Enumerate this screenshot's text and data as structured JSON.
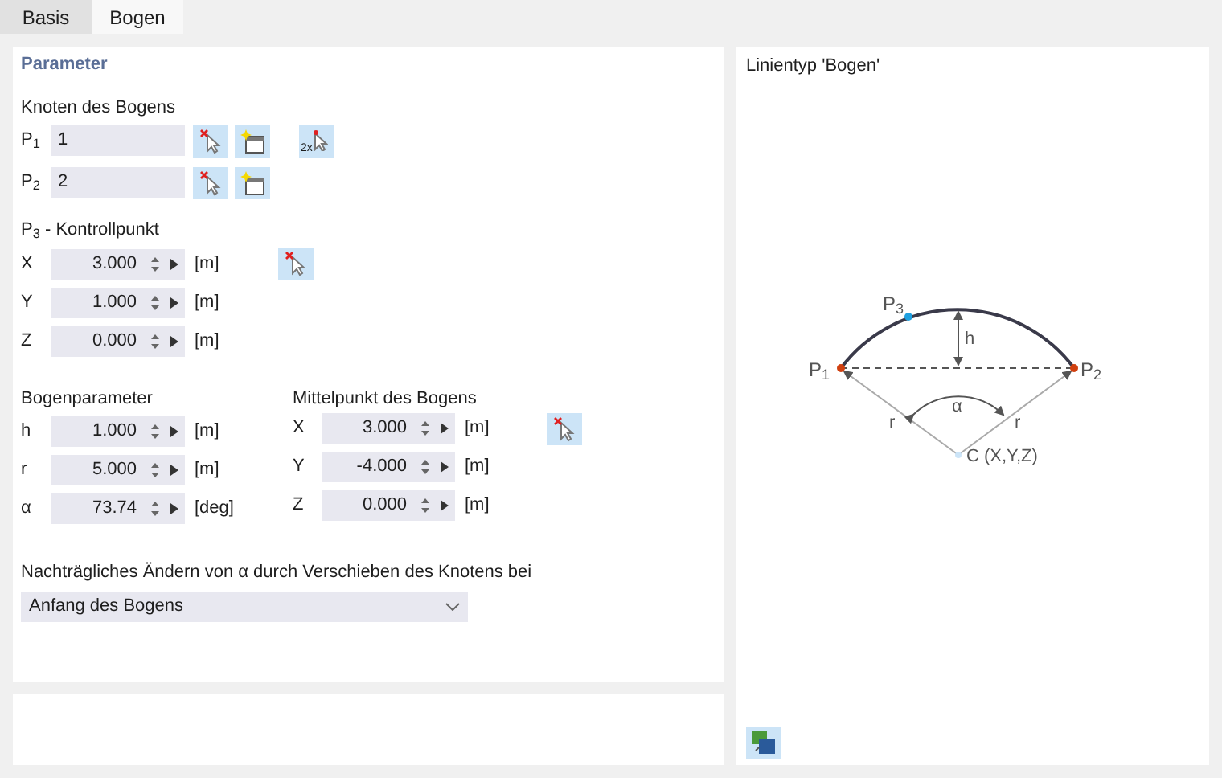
{
  "tabs": [
    {
      "label": "Basis",
      "selected": false
    },
    {
      "label": "Bogen",
      "selected": true
    }
  ],
  "parameter": {
    "title": "Parameter",
    "nodes": {
      "title": "Knoten des Bogens",
      "double_pick_label": "2x",
      "rows": [
        {
          "label": "P$_{1}$",
          "value": "1"
        },
        {
          "label": "P$_{2}$",
          "value": "2"
        }
      ]
    },
    "control_point": {
      "title": "P$_{3}$ - Kontrollpunkt",
      "rows": [
        {
          "label": "X",
          "value": "3.000",
          "unit": "[m]"
        },
        {
          "label": "Y",
          "value": "1.000",
          "unit": "[m]"
        },
        {
          "label": "Z",
          "value": "0.000",
          "unit": "[m]"
        }
      ]
    },
    "arc_parameters": {
      "title": "Bogenparameter",
      "rows": [
        {
          "label": "h",
          "value": "1.000",
          "unit": "[m]"
        },
        {
          "label": "r",
          "value": "5.000",
          "unit": "[m]"
        },
        {
          "label": "α",
          "value": "73.74",
          "unit": "[deg]"
        }
      ]
    },
    "center": {
      "title": "Mittelpunkt des Bogens",
      "rows": [
        {
          "label": "X",
          "value": "3.000",
          "unit": "[m]"
        },
        {
          "label": "Y",
          "value": "-4.000",
          "unit": "[m]"
        },
        {
          "label": "Z",
          "value": "0.000",
          "unit": "[m]"
        }
      ]
    },
    "modify": {
      "label": "Nachträgliches Ändern von α durch Verschieben des Knotens bei",
      "value": "Anfang des Bogens"
    }
  },
  "preview": {
    "title": "Linientyp 'Bogen'",
    "labels": {
      "p1": "P$_{1}$",
      "p2": "P$_{2}$",
      "p3": "P$_{3}$",
      "h": "h",
      "alpha": "α",
      "r_left": "r",
      "r_right": "r",
      "center": "C (X,Y,Z)"
    }
  }
}
